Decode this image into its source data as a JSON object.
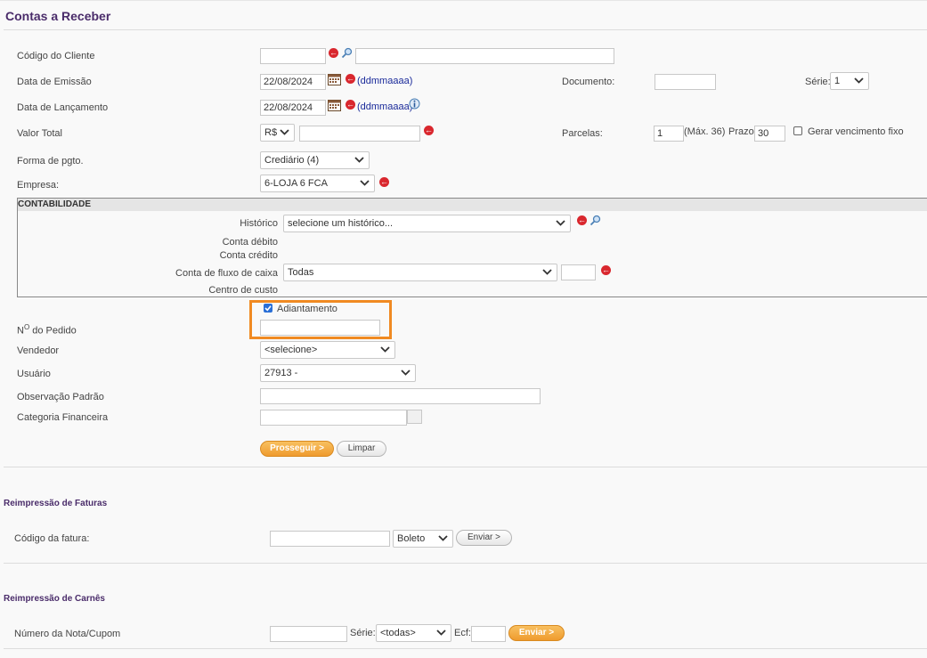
{
  "page": {
    "title": "Contas a Receber"
  },
  "form": {
    "codigo_cliente": {
      "label": "Código do Cliente",
      "code_value": "",
      "name_value": ""
    },
    "data_emissao": {
      "label": "Data de Emissão",
      "value": "22/08/2024",
      "hint": "(ddmmaaaa)"
    },
    "data_lancamento": {
      "label": "Data de Lançamento",
      "value": "22/08/2024",
      "hint": "(ddmmaaaa)"
    },
    "valor_total": {
      "label": "Valor Total",
      "currency": "R$",
      "value": ""
    },
    "forma_pgto": {
      "label": "Forma de pgto.",
      "value": "Crediário (4)"
    },
    "empresa": {
      "label": "Empresa:",
      "value": "6-LOJA 6 FCA"
    },
    "documento": {
      "label": "Documento:",
      "value": ""
    },
    "serie": {
      "label": "Série:",
      "value": "1"
    },
    "parcelas": {
      "label": "Parcelas:",
      "value": "1",
      "max_hint": "(Máx. 36)"
    },
    "prazo": {
      "label": "Prazo:",
      "value": "30"
    },
    "gerar_vencimento": {
      "label": "Gerar vencimento fixo",
      "checked": false
    },
    "contabilidade": {
      "header": "CONTABILIDADE",
      "historico": {
        "label": "Histórico",
        "value": "selecione um histórico..."
      },
      "conta_debito": {
        "label": "Conta débito"
      },
      "conta_credito": {
        "label": "Conta crédito"
      },
      "conta_fluxo": {
        "label": "Conta de fluxo de caixa",
        "value": "Todas",
        "code": ""
      },
      "centro_custo": {
        "label": "Centro de custo"
      }
    },
    "adiantamento": {
      "label": "Adiantamento",
      "checked": true
    },
    "numero_pedido": {
      "label_prefix": "N",
      "label_sup": "O",
      "label_suffix": " do Pedido",
      "value": ""
    },
    "vendedor": {
      "label": "Vendedor",
      "value": "<selecione>"
    },
    "usuario": {
      "label": "Usuário",
      "value": "27913 -"
    },
    "observacao": {
      "label": "Observação Padrão",
      "value": ""
    },
    "categoria": {
      "label": "Categoria Financeira",
      "value": ""
    },
    "buttons": {
      "prosseguir": "Prosseguir >",
      "limpar": "Limpar"
    }
  },
  "faturas": {
    "title": "Reimpressão de Faturas",
    "codigo_label": "Código da fatura:",
    "codigo_value": "",
    "tipo": "Boleto",
    "enviar": "Enviar >"
  },
  "carnes": {
    "title": "Reimpressão de Carnês",
    "numero_label": "Número da Nota/Cupom",
    "numero_value": "",
    "serie_label": "Série:",
    "serie_value": "<todas>",
    "ecf_label": "Ecf:",
    "ecf_value": "",
    "enviar": "Enviar >"
  },
  "colors": {
    "accent": "#f08a22",
    "title": "#4a2c6a",
    "link": "#1a2a9a",
    "danger": "#d9272e"
  },
  "icons": [
    "back-arrow-icon",
    "search-icon",
    "calendar-icon",
    "info-icon",
    "chevron-down-icon"
  ]
}
